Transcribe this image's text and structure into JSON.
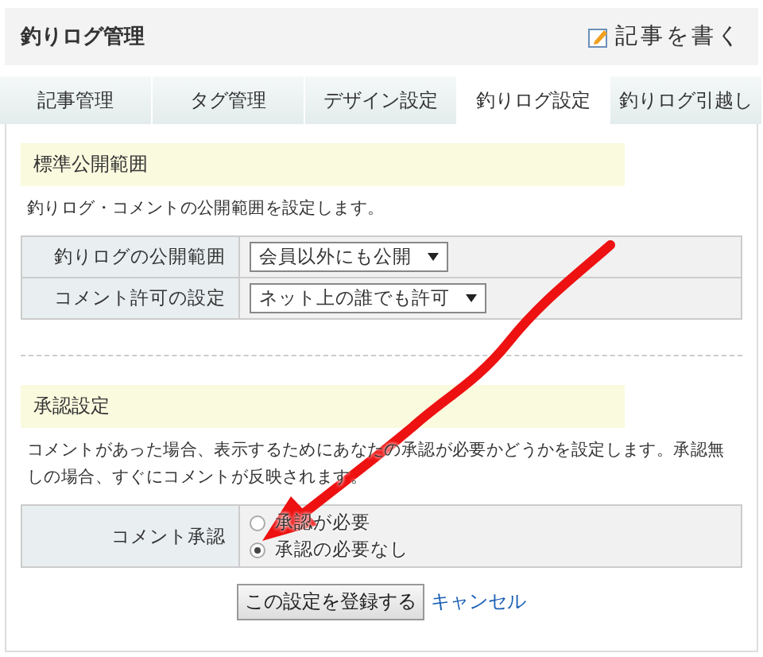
{
  "header": {
    "title": "釣りログ管理",
    "write_link": "記事を書く"
  },
  "tabs": [
    {
      "label": "記事管理",
      "selected": false
    },
    {
      "label": "タグ管理",
      "selected": false
    },
    {
      "label": "デザイン設定",
      "selected": false
    },
    {
      "label": "釣りログ設定",
      "selected": true
    },
    {
      "label": "釣りログ引越し",
      "selected": false
    }
  ],
  "sections": [
    {
      "heading": "標準公開範囲",
      "description": "釣りログ・コメントの公開範囲を設定します。",
      "rows": [
        {
          "kind": "select",
          "label": "釣りログの公開範囲",
          "value": "会員以外にも公開"
        },
        {
          "kind": "select",
          "label": "コメント許可の設定",
          "value": "ネット上の誰でも許可"
        }
      ]
    },
    {
      "heading": "承認設定",
      "description": "コメントがあった場合、表示するためにあなたの承認が必要かどうかを設定します。承認無しの場合、すぐにコメントが反映されます。",
      "rows": [
        {
          "kind": "radio",
          "label": "コメント承認",
          "options": [
            {
              "label": "承認が必要",
              "selected": false
            },
            {
              "label": "承認の必要なし",
              "selected": true
            }
          ]
        }
      ]
    }
  ],
  "buttons": {
    "submit": "この設定を登録する",
    "cancel": "キャンセル"
  }
}
